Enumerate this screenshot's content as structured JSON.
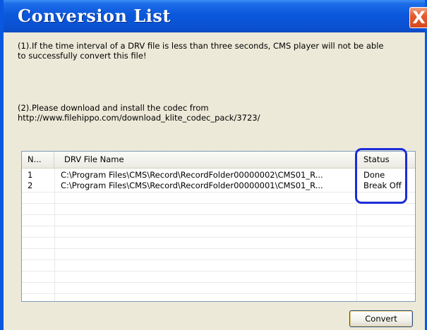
{
  "window": {
    "title": "Conversion List",
    "close_label": "X"
  },
  "notes": {
    "note1": "(1).If the time interval of a DRV file is less than three seconds, CMS player will not be able\nto successfully convert this file!",
    "note2": "(2).Please download and install the codec from\nhttp://www.filehippo.com/download_klite_codec_pack/3723/"
  },
  "list": {
    "columns": [
      "N...",
      "DRV File Name",
      "Status"
    ],
    "rows": [
      {
        "no": "1",
        "file": "C:\\Program Files\\CMS\\Record\\RecordFolder00000002\\CMS01_R...",
        "status": "Done"
      },
      {
        "no": "2",
        "file": "C:\\Program Files\\CMS\\Record\\RecordFolder00000001\\CMS01_R...",
        "status": "Break Off"
      }
    ]
  },
  "buttons": {
    "convert_label": "Convert"
  },
  "colors": {
    "titlebar": "#0a52d2",
    "highlight": "#1b2bd8",
    "close": "#e45a2e"
  }
}
